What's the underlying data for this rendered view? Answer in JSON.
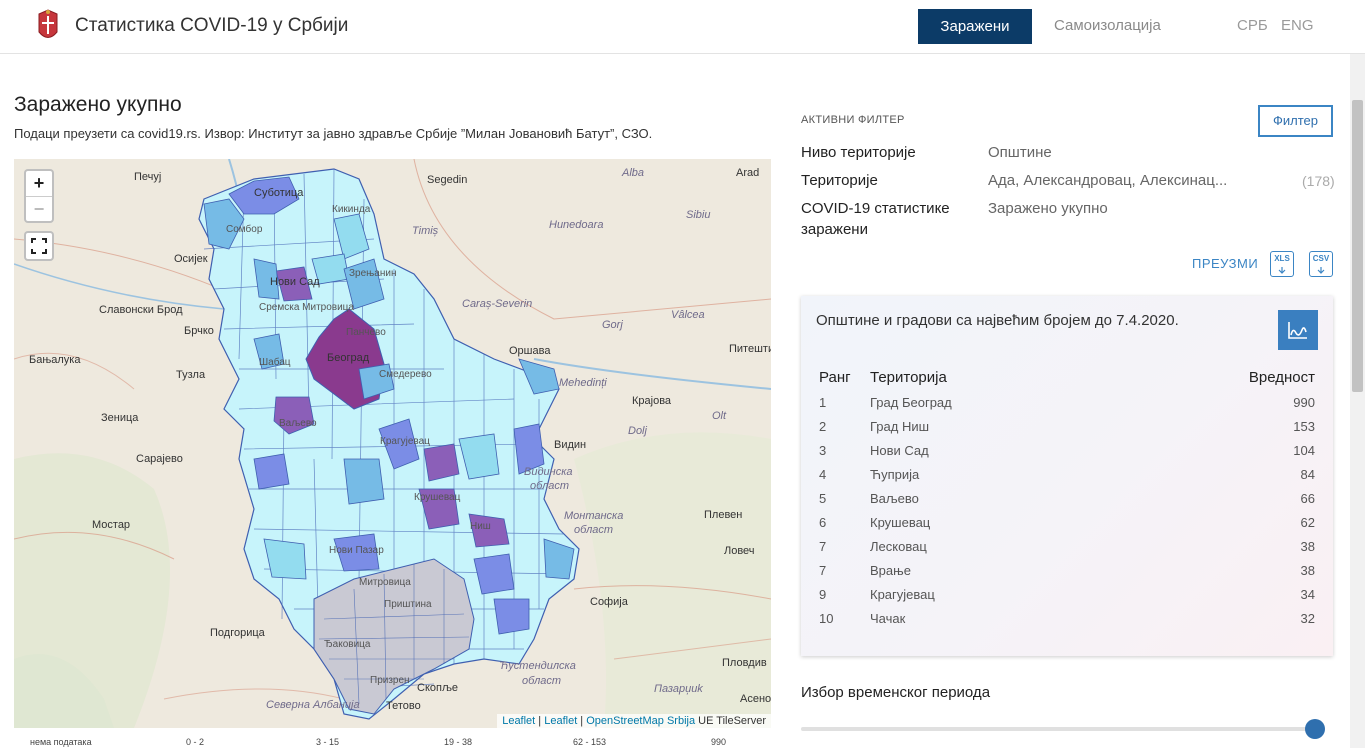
{
  "header": {
    "title": "Статистика COVID-19 у Србији",
    "nav": [
      {
        "label": "Заражени",
        "active": true
      },
      {
        "label": "Самоизолација",
        "active": false
      }
    ],
    "languages": [
      "СРБ",
      "ENG"
    ]
  },
  "main": {
    "title": "Заражено укупно",
    "source": "Подаци преузети са covid19.rs. Извор: Институт за јавно здравље Србије ”Милан Јовановић Батут”, СЗО."
  },
  "map": {
    "zoom_in": "+",
    "zoom_out": "−",
    "labels": {
      "pecuj": "Печуј",
      "subotica": "Суботица",
      "arad": "Arad",
      "szeged": "Segedin",
      "alba": "Alba",
      "kikinda": "Кикинда",
      "sibiu": "Sibiu",
      "timis": "Timiș",
      "hunedoara": "Hunedoara",
      "sombor": "Сомбор",
      "osijek": "Осијек",
      "zrenjanin": "Зрењанин",
      "novi_sad": "Нови Сад",
      "caras": "Caraș-Severin",
      "valcea": "Vâlcea",
      "slavonski_brod": "Славонски Брод",
      "brcko": "Брчко",
      "gorj": "Gorj",
      "pancevo": "Панчево",
      "sremska": "Сремска Митровица",
      "sabac": "Шабац",
      "pitesti": "Питешти",
      "banjaluka": "Бањалука",
      "beograd": "Београд",
      "orsava": "Оршава",
      "tuzla": "Тузла",
      "smederevo": "Смедерево",
      "mehedinti": "Mehedinți",
      "zenica": "Зеница",
      "valjevo": "Ваљево",
      "kragujevac": "Крагујевац",
      "olt": "Olt",
      "dolj": "Dolj",
      "krajova": "Крајова",
      "sarajevo": "Сарајево",
      "vidin": "Видин",
      "vidinska": "Видинска",
      "oblast": "област",
      "krusevac": "Крушевац",
      "mostar": "Мостар",
      "nis": "Ниш",
      "montanska": "Монтанска",
      "oblast2": "област",
      "pleven": "Плевен",
      "lovec": "Ловеч",
      "novi_pazar": "Нови Пазар",
      "mitrovica": "Митровица",
      "pristina": "Приштина",
      "sofija": "Софија",
      "podgorica": "Подгорица",
      "djakovica": "Ђаковица",
      "kjustendil": "Ћустендилска",
      "oblast3": "област",
      "plovdiv": "Пловдив",
      "prizren": "Призрен",
      "pazardzik": "Пазарџиk",
      "skopje": "Скопље",
      "tetovo": "Тетово",
      "albanija": "Северна Албанија",
      "asenovgrad": "Асеновгр"
    },
    "attribution": {
      "leaflet1": "Leaflet",
      "sep1": " | ",
      "leaflet2": "Leaflet",
      "sep2": " | ",
      "osm": "OpenStreetMap Srbija",
      "tile": " UE TileServer"
    },
    "colors": {
      "land": "#eee9de",
      "no_data": "#c9c9d3",
      "bin1": "#c7f4fb",
      "bin2": "#93dcef",
      "bin3": "#76bbe6",
      "bin4": "#7b8de6",
      "bin5": "#8b5fb8",
      "bin6": "#8a3a8e",
      "boundary": "#3f5fb0"
    }
  },
  "legend": {
    "items": [
      "нема података",
      "0 - 2",
      "3 - 15",
      "19 - 38",
      "62 - 153",
      "990"
    ]
  },
  "filter": {
    "heading": "АКТИВНИ ФИЛТЕР",
    "button": "Филтер",
    "rows": [
      {
        "label": "Ниво територије",
        "value": "Општине",
        "count": ""
      },
      {
        "label": "Територије",
        "value": "Ада, Александровац, Алексинац...",
        "count": "(178)"
      },
      {
        "label": "COVID-19 статистике",
        "label2": "заражени",
        "value": "Заражено укупно",
        "count": ""
      }
    ],
    "download_label": "ПРЕУЗМИ",
    "xls": "XLS",
    "csv": "CSV"
  },
  "card": {
    "title": "Општине и градови са највећим бројем до 7.4.2020.",
    "headers": {
      "rank": "Ранг",
      "territory": "Територија",
      "value": "Вредност"
    },
    "rows": [
      {
        "rank": "1",
        "territory": "Град Београд",
        "value": "990"
      },
      {
        "rank": "2",
        "territory": "Град Ниш",
        "value": "153"
      },
      {
        "rank": "3",
        "territory": "Нови Сад",
        "value": "104"
      },
      {
        "rank": "4",
        "territory": "Ћуприја",
        "value": "84"
      },
      {
        "rank": "5",
        "territory": "Ваљево",
        "value": "66"
      },
      {
        "rank": "6",
        "territory": "Крушевац",
        "value": "62"
      },
      {
        "rank": "7",
        "territory": "Лесковац",
        "value": "38"
      },
      {
        "rank": "7",
        "territory": "Врање",
        "value": "38"
      },
      {
        "rank": "9",
        "territory": "Крагујевац",
        "value": "34"
      },
      {
        "rank": "10",
        "territory": "Чачак",
        "value": "32"
      }
    ]
  },
  "period": {
    "title": "Избор временског периода",
    "position": 1.0
  }
}
